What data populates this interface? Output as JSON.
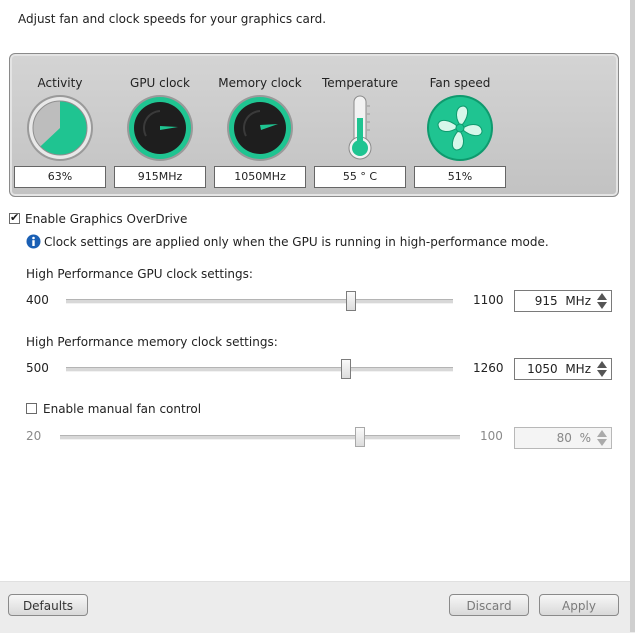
{
  "header": {
    "description": "Adjust fan and clock speeds for your graphics card."
  },
  "gauges": [
    {
      "label": "Activity",
      "value": "63%",
      "fraction": 0.63
    },
    {
      "label": "GPU clock",
      "value": "915MHz"
    },
    {
      "label": "Memory clock",
      "value": "1050MHz"
    },
    {
      "label": "Temperature",
      "value": "55 ° C"
    },
    {
      "label": "Fan speed",
      "value": "51%"
    }
  ],
  "overdrive": {
    "enable_label": "Enable Graphics OverDrive",
    "enabled": true,
    "info_text": "Clock settings are applied only when the GPU is running in high-performance mode."
  },
  "gpu_clock": {
    "title": "High Performance GPU clock settings:",
    "min": "400",
    "max": "1100",
    "value": "915",
    "unit": "MHz",
    "position": 0.736
  },
  "memory_clock": {
    "title": "High Performance memory clock settings:",
    "min": "500",
    "max": "1260",
    "value": "1050",
    "unit": "MHz",
    "position": 0.724
  },
  "fan": {
    "enable_label": "Enable manual fan control",
    "enabled": false,
    "min": "20",
    "max": "100",
    "value": "80",
    "unit": "%",
    "position": 0.75
  },
  "footer": {
    "defaults": "Defaults",
    "discard": "Discard",
    "apply": "Apply"
  },
  "colors": {
    "accent": "#1fc491",
    "accent_dark": "#0f9a6e",
    "dial": "#1e1e1e",
    "panel": "#c8c8c8",
    "info": "#1a5fb4"
  },
  "icons": {
    "info": "info-icon",
    "thermometer": "thermometer-icon",
    "fan": "fan-icon"
  }
}
